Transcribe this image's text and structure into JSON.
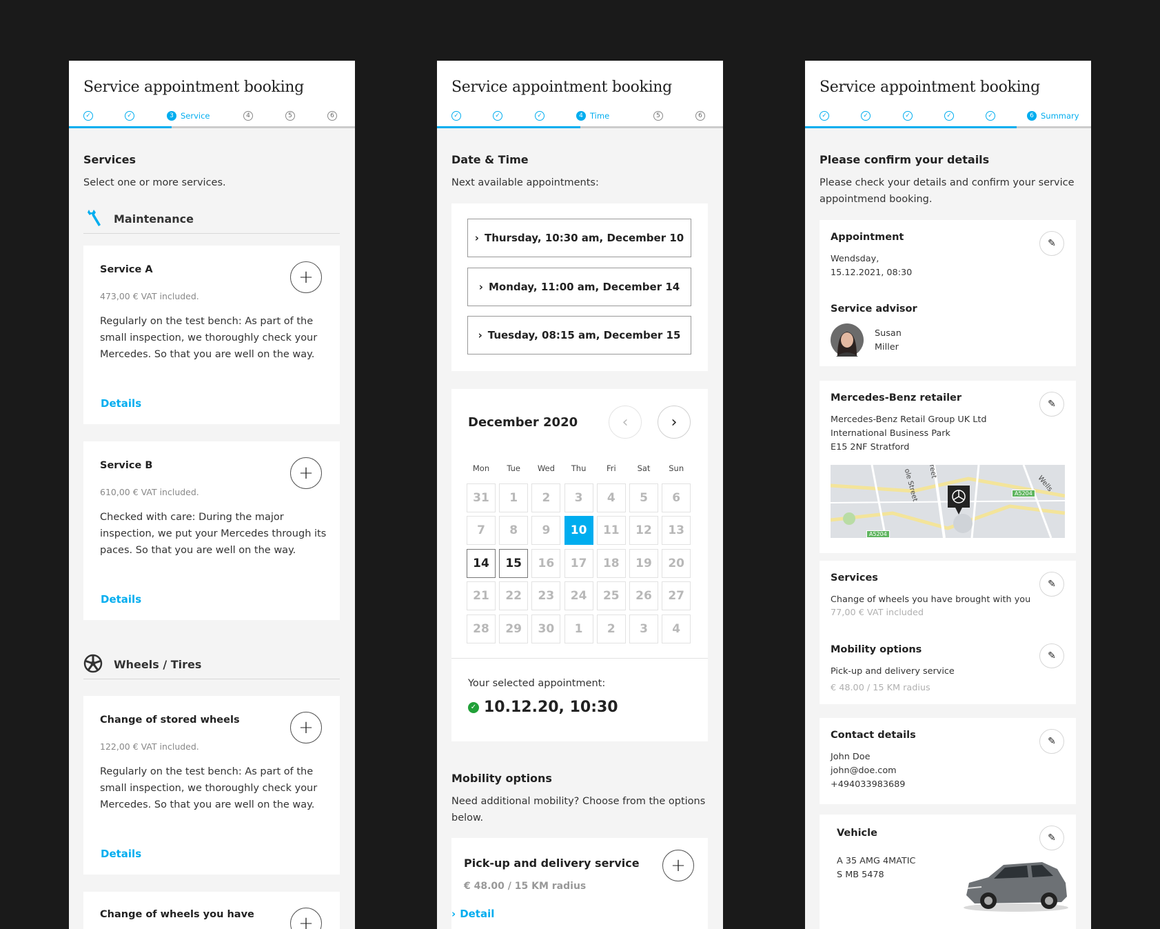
{
  "app_title": "Service appointment booking",
  "accent_color": "#00adef",
  "panel1": {
    "steps": [
      {
        "state": "done",
        "text": "✓",
        "label": ""
      },
      {
        "state": "done",
        "text": "✓",
        "label": ""
      },
      {
        "state": "active",
        "text": "3",
        "label": "Service"
      },
      {
        "state": "todo",
        "text": "4",
        "label": ""
      },
      {
        "state": "todo",
        "text": "5",
        "label": ""
      },
      {
        "state": "todo",
        "text": "6",
        "label": ""
      }
    ],
    "progress_fraction": 0.36,
    "heading": "Services",
    "subheading": "Select one or more services.",
    "category_maintenance": {
      "label": "Maintenance",
      "icon": "wrench-icon"
    },
    "category_wheels": {
      "label": "Wheels / Tires",
      "icon": "wheel-icon"
    },
    "services": [
      {
        "title": "Service A",
        "price": "473,00 €  VAT included.",
        "desc": "Regularly on the test bench: As part of the small inspection, we thoroughly check your Mercedes. So that you are well on the way.",
        "link": "Details"
      },
      {
        "title": "Service B",
        "price": "610,00 €  VAT included.",
        "desc": "Checked with care: During the major inspection, we put your Mercedes through its paces. So that you are well on the way.",
        "link": "Details"
      },
      {
        "title": "Change of stored wheels",
        "price": "122,00 €  VAT included.",
        "desc": "Regularly on the test bench: As part of the small inspection, we thoroughly check your Mercedes. So that you are well on the way.",
        "link": "Details"
      },
      {
        "title": "Change of wheels you have",
        "price": "",
        "desc": "",
        "link": ""
      }
    ]
  },
  "panel2": {
    "steps": [
      {
        "state": "done",
        "text": "✓",
        "label": ""
      },
      {
        "state": "done",
        "text": "✓",
        "label": ""
      },
      {
        "state": "done",
        "text": "✓",
        "label": ""
      },
      {
        "state": "active",
        "text": "4",
        "label": "Time"
      },
      {
        "state": "todo",
        "text": "5",
        "label": ""
      },
      {
        "state": "todo",
        "text": "6",
        "label": ""
      }
    ],
    "progress_fraction": 0.5,
    "heading": "Date & Time",
    "subheading": "Next available appointments:",
    "slots": [
      "Thursday, 10:30 am, December 10",
      "Monday, 11:00 am, December 14",
      "Tuesday, 08:15 am, December 15"
    ],
    "calendar": {
      "month": "December 2020",
      "weekdays": [
        "Mon",
        "Tue",
        "Wed",
        "Thu",
        "Fri",
        "Sat",
        "Sun"
      ],
      "days": [
        [
          "31",
          "1",
          "2",
          "3",
          "4",
          "5",
          "6"
        ],
        [
          "7",
          "8",
          "9",
          "10",
          "11",
          "12",
          "13"
        ],
        [
          "14",
          "15",
          "16",
          "17",
          "18",
          "19",
          "20"
        ],
        [
          "21",
          "22",
          "23",
          "24",
          "25",
          "26",
          "27"
        ],
        [
          "28",
          "29",
          "30",
          "1",
          "2",
          "3",
          "4"
        ]
      ],
      "selected_day": "10",
      "available_days": [
        "14",
        "15"
      ]
    },
    "selected_label": "Your selected appointment:",
    "selected_value": "10.12.20, 10:30",
    "mobility_heading": "Mobility options",
    "mobility_sub": "Need additional mobility? Choose from the options below.",
    "mobility_card": {
      "title": "Pick-up and delivery service",
      "price": "€ 48.00 / 15 KM radius",
      "link": "Detail"
    }
  },
  "panel3": {
    "steps": [
      {
        "state": "done",
        "text": "✓",
        "label": ""
      },
      {
        "state": "done",
        "text": "✓",
        "label": ""
      },
      {
        "state": "done",
        "text": "✓",
        "label": ""
      },
      {
        "state": "done",
        "text": "✓",
        "label": ""
      },
      {
        "state": "done",
        "text": "✓",
        "label": ""
      },
      {
        "state": "active",
        "text": "6",
        "label": "Summary"
      }
    ],
    "progress_fraction": 0.74,
    "heading": "Please confirm your details",
    "subheading": "Please check your details and confirm your service appointmend booking.",
    "appointment": {
      "label": "Appointment",
      "line1": "Wendsday,",
      "line2": "15.12.2021, 08:30"
    },
    "advisor": {
      "label": "Service advisor",
      "first": "Susan",
      "last": "Miller"
    },
    "retailer": {
      "label": "Mercedes-Benz retailer",
      "line1": "Mercedes-Benz Retail Group UK Ltd",
      "line2": "International Business Park",
      "line3": "E15 2NF Stratford",
      "map_labels": [
        "A5204",
        "A5204",
        "Wells",
        "ole Street",
        "reet"
      ]
    },
    "services": {
      "label": "Services",
      "line1": "Change of wheels you have brought with you",
      "line2": "77,00 € VAT included"
    },
    "mobility": {
      "label": "Mobility options",
      "line1": "Pick-up and delivery service",
      "line2": "€ 48.00 / 15 KM radius"
    },
    "contact": {
      "label": "Contact details",
      "name": "John Doe",
      "email": "john@doe.com",
      "phone": "+494033983689"
    },
    "vehicle": {
      "label": "Vehicle",
      "model": "A 35 AMG 4MATIC",
      "plate": "S MB 5478"
    }
  }
}
